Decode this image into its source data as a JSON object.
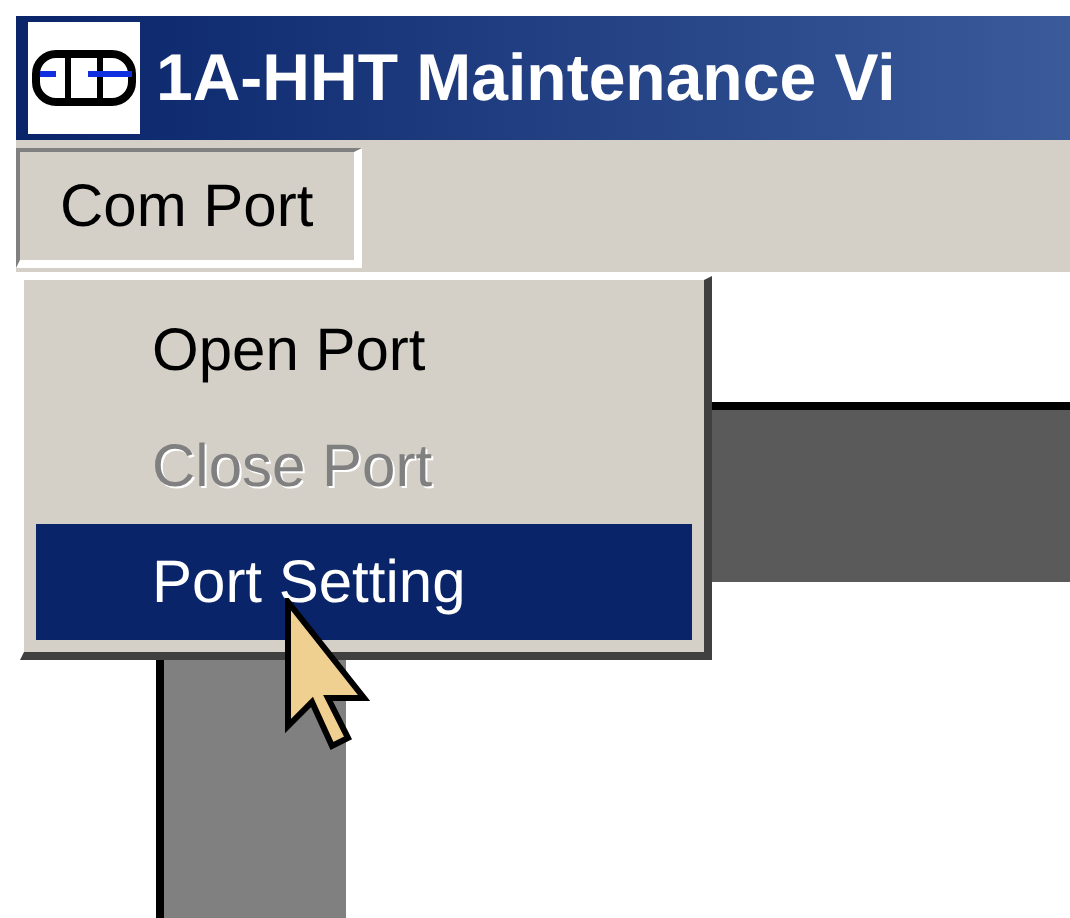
{
  "window": {
    "title": "1A-HHT Maintenance Vi"
  },
  "menu_bar": [
    {
      "label": "Com Port",
      "selected": true
    }
  ],
  "dropdown": {
    "items": [
      {
        "label": "Open Port",
        "disabled": false,
        "selected": false
      },
      {
        "label": "Close Port",
        "disabled": true,
        "selected": false
      },
      {
        "label": "Port Setting",
        "disabled": false,
        "selected": true
      }
    ]
  }
}
